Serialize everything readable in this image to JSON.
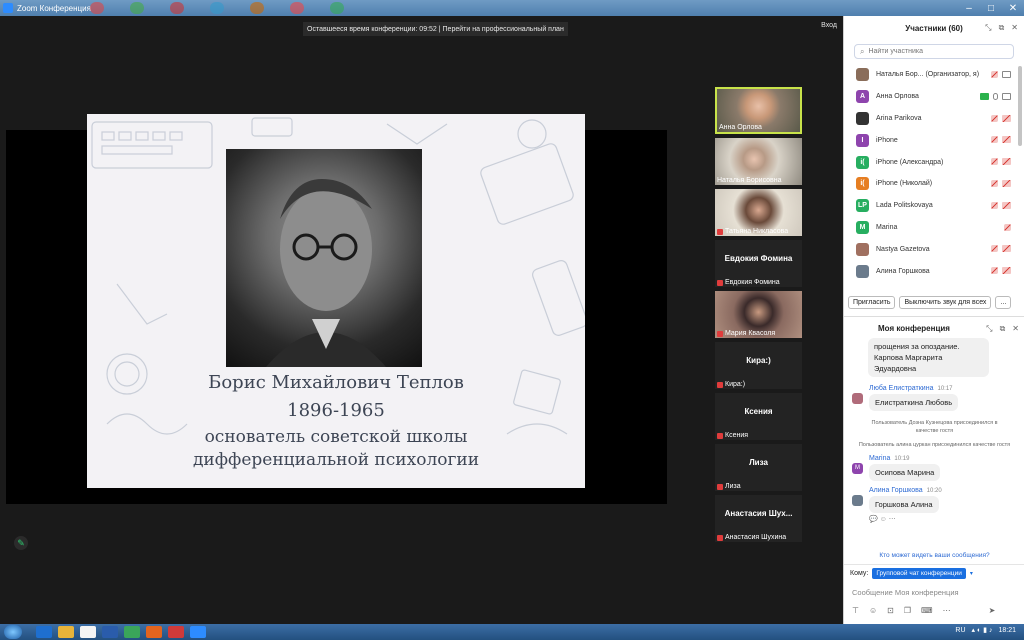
{
  "window": {
    "title": "Zoom Конференция",
    "app_icon": "zoom-icon"
  },
  "meeting": {
    "time_banner": "Оставшееся время конференции: 09:52 | Перейти на профессиональный план",
    "exit_label": "Вход"
  },
  "slide": {
    "line1": "Борис Михайлович Теплов",
    "line2": "1896-1965",
    "line3": "основатель советской школы",
    "line4": "дифференциальной  психологии"
  },
  "gallery": [
    {
      "name": "Анна Орлова",
      "big": "",
      "video": true,
      "active": true,
      "muted": false
    },
    {
      "name": "Наталья Борисовна",
      "big": "",
      "video": true,
      "active": false,
      "muted": false
    },
    {
      "name": "Татьяна Никласова",
      "big": "",
      "video": true,
      "active": false,
      "muted": true
    },
    {
      "name": "Евдокия Фомина",
      "big": "Евдокия Фомина",
      "video": false,
      "active": false,
      "muted": true
    },
    {
      "name": "Мария Квасоля",
      "big": "",
      "video": true,
      "active": false,
      "muted": true
    },
    {
      "name": "Кира:)",
      "big": "Кира:)",
      "video": false,
      "active": false,
      "muted": true
    },
    {
      "name": "Ксения",
      "big": "Ксения",
      "video": false,
      "active": false,
      "muted": true
    },
    {
      "name": "Лиза",
      "big": "Лиза",
      "video": false,
      "active": false,
      "muted": true
    },
    {
      "name": "Анастасия Шухина",
      "big": "Анастасия  Шух...",
      "video": false,
      "active": false,
      "muted": true
    }
  ],
  "participants": {
    "title": "Участники (60)",
    "search_placeholder": "Найти участника",
    "list": [
      {
        "avatar": "",
        "color": "#8a6d5a",
        "name": "Наталья Бор...  (Организатор, я)",
        "status": "mic-red cam-gray"
      },
      {
        "avatar": "А",
        "color": "#8e44ad",
        "name": "Анна Орлова",
        "status": "share-green mic-gray cam-gray"
      },
      {
        "avatar": "",
        "color": "#333333",
        "name": "Arina Parikova",
        "status": "mic-red cam-red"
      },
      {
        "avatar": "I",
        "color": "#8e44ad",
        "name": "iPhone",
        "status": "mic-red cam-red"
      },
      {
        "avatar": "i(",
        "color": "#27ae60",
        "name": "iPhone (Александра)",
        "status": "mic-red cam-red"
      },
      {
        "avatar": "i(",
        "color": "#e67e22",
        "name": "iPhone (Николай)",
        "status": "mic-red cam-red"
      },
      {
        "avatar": "LP",
        "color": "#27ae60",
        "name": "Lada Politskovaya",
        "status": "mic-red cam-red"
      },
      {
        "avatar": "M",
        "color": "#27ae60",
        "name": "Marina",
        "status": "mic-red"
      },
      {
        "avatar": "",
        "color": "#a07060",
        "name": "Nastya Gazetova",
        "status": "mic-red cam-red"
      },
      {
        "avatar": "",
        "color": "#6b7b8c",
        "name": "Алина Горшкова",
        "status": "mic-red cam-red"
      }
    ],
    "invite_label": "Пригласить",
    "mute_all_label": "Выключить звук для всех",
    "more_label": "..."
  },
  "chat": {
    "title": "Моя конференция",
    "messages": [
      {
        "sender": "",
        "time": "",
        "text": "прощения за опоздание. Карпова Маргарита Эдуардовна"
      },
      {
        "sender": "Люба Елистраткина",
        "time": "10:17",
        "text": "Елистраткина Любовь"
      },
      {
        "system": "Пользователь Дозна Кузнецова присоединился в качестве гостя"
      },
      {
        "system": "Пользователь алина цуркан присоединился качестве гостя"
      },
      {
        "sender": "Marina",
        "time": "10:19",
        "text": "Осипова Марина"
      },
      {
        "sender": "Алина Горшкова",
        "time": "10:20",
        "text": "Горшкова Алина"
      }
    ],
    "who_can_see": "Кто может видеть ваши сообщения?",
    "to_label": "Кому:",
    "to_value": "Групповой чат конференции",
    "input_placeholder": "Сообщение Моя конференция"
  },
  "taskbar": {
    "lang": "RU",
    "clock": "18:21"
  }
}
